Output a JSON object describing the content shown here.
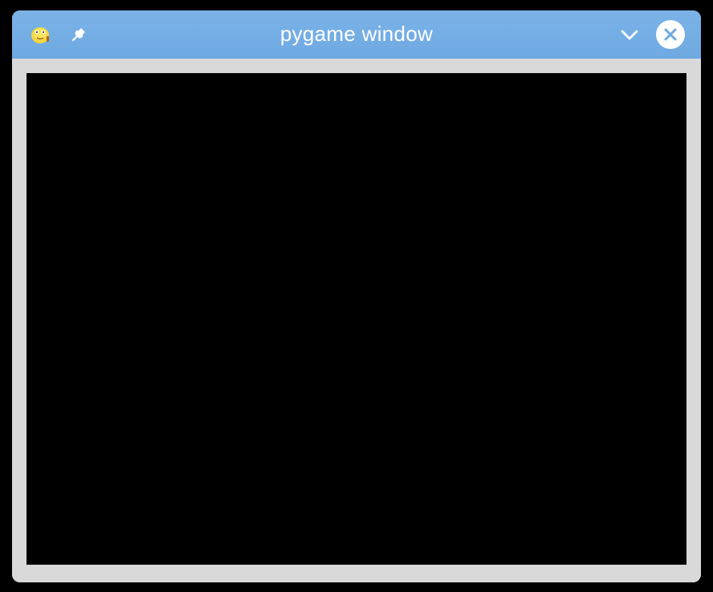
{
  "window": {
    "title": "pygame window"
  },
  "colors": {
    "titlebar": "#6ea9e1",
    "canvas": "#000000",
    "frame": "#d9d9d9"
  }
}
